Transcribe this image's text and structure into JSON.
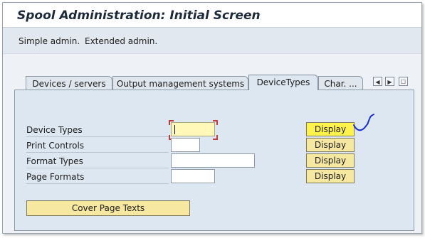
{
  "window": {
    "title": "Spool Administration: Initial Screen"
  },
  "toolbar": {
    "items": [
      "Simple admin.",
      "Extended admin."
    ]
  },
  "tabs": [
    {
      "label": "Devices / servers"
    },
    {
      "label": "Output management systems"
    },
    {
      "label": "DeviceTypes"
    },
    {
      "label": "Char. ..."
    }
  ],
  "active_tab": "DeviceTypes",
  "form": {
    "rows": [
      {
        "label": "Device Types",
        "value": "",
        "button": "Display"
      },
      {
        "label": "Print Controls",
        "value": "",
        "button": "Display"
      },
      {
        "label": "Format Types",
        "value": "",
        "button": "Display"
      },
      {
        "label": "Page Formats",
        "value": "",
        "button": "Display"
      }
    ],
    "cover_button": "Cover Page Texts"
  },
  "colors": {
    "button": "#f6e7a1",
    "highlight": "#fff24d",
    "panel": "#dde7f1",
    "annotation": "#1a2fd0"
  }
}
